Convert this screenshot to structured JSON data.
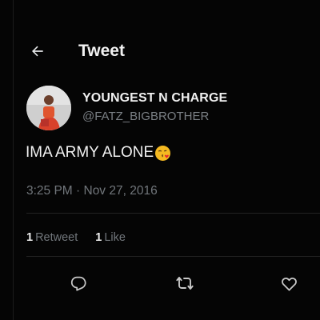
{
  "header": {
    "title": "Tweet",
    "back_icon": "arrow-left-icon"
  },
  "tweet": {
    "display_name": "YOUNGEST N CHARGE",
    "handle": "@FATZ_BIGBROTHER",
    "text": "IMA ARMY ALONE",
    "emoji": "face-blowing-kiss-emoji",
    "timestamp": "3:25 PM · Nov 27, 2016"
  },
  "stats": {
    "retweets_count": "1",
    "retweets_label": "Retweet",
    "likes_count": "1",
    "likes_label": "Like"
  },
  "actions": [
    "reply-icon",
    "retweet-icon",
    "like-icon"
  ],
  "colors": {
    "background": "#050505",
    "primary_text": "#e7e9ea",
    "secondary_text": "#71767b",
    "divider": "#222222"
  }
}
